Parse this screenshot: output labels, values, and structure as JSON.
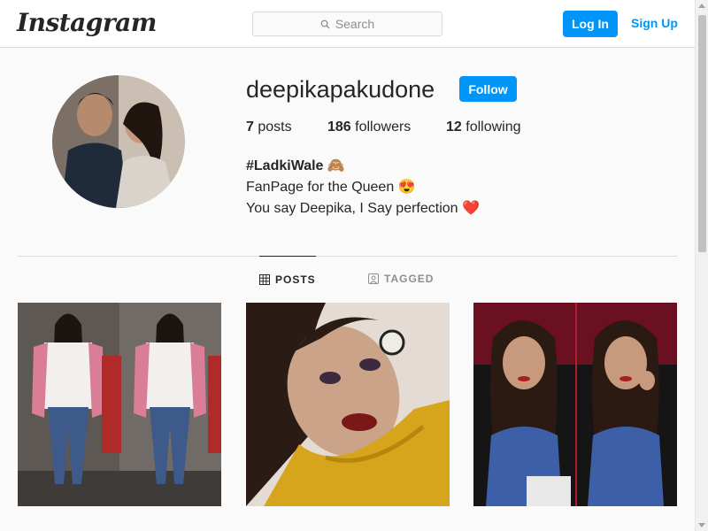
{
  "header": {
    "logo_text": "Instagram",
    "search_placeholder": "Search",
    "login_label": "Log In",
    "signup_label": "Sign Up"
  },
  "profile": {
    "username": "deepikapakudone",
    "follow_label": "Follow",
    "stats": {
      "posts_count": "7",
      "posts_label": "posts",
      "followers_count": "186",
      "followers_label": "followers",
      "following_count": "12",
      "following_label": "following"
    },
    "bio": {
      "line1": "#LadkiWale 🙈",
      "line2": "FanPage for the Queen 😍",
      "line3": "You say Deepika, I Say perfection ❤️"
    }
  },
  "tabs": [
    {
      "label": "POSTS",
      "icon": "grid-icon",
      "active": true
    },
    {
      "label": "TAGGED",
      "icon": "tag-icon",
      "active": false
    }
  ],
  "posts": [
    {
      "description_icon": "photo-icon"
    },
    {
      "description_icon": "photo-icon"
    },
    {
      "description_icon": "photo-icon"
    }
  ],
  "colors": {
    "accent": "#0095f6",
    "text": "#262626",
    "muted": "#8e8e8e",
    "border": "#dbdbdb",
    "background": "#fafafa"
  }
}
